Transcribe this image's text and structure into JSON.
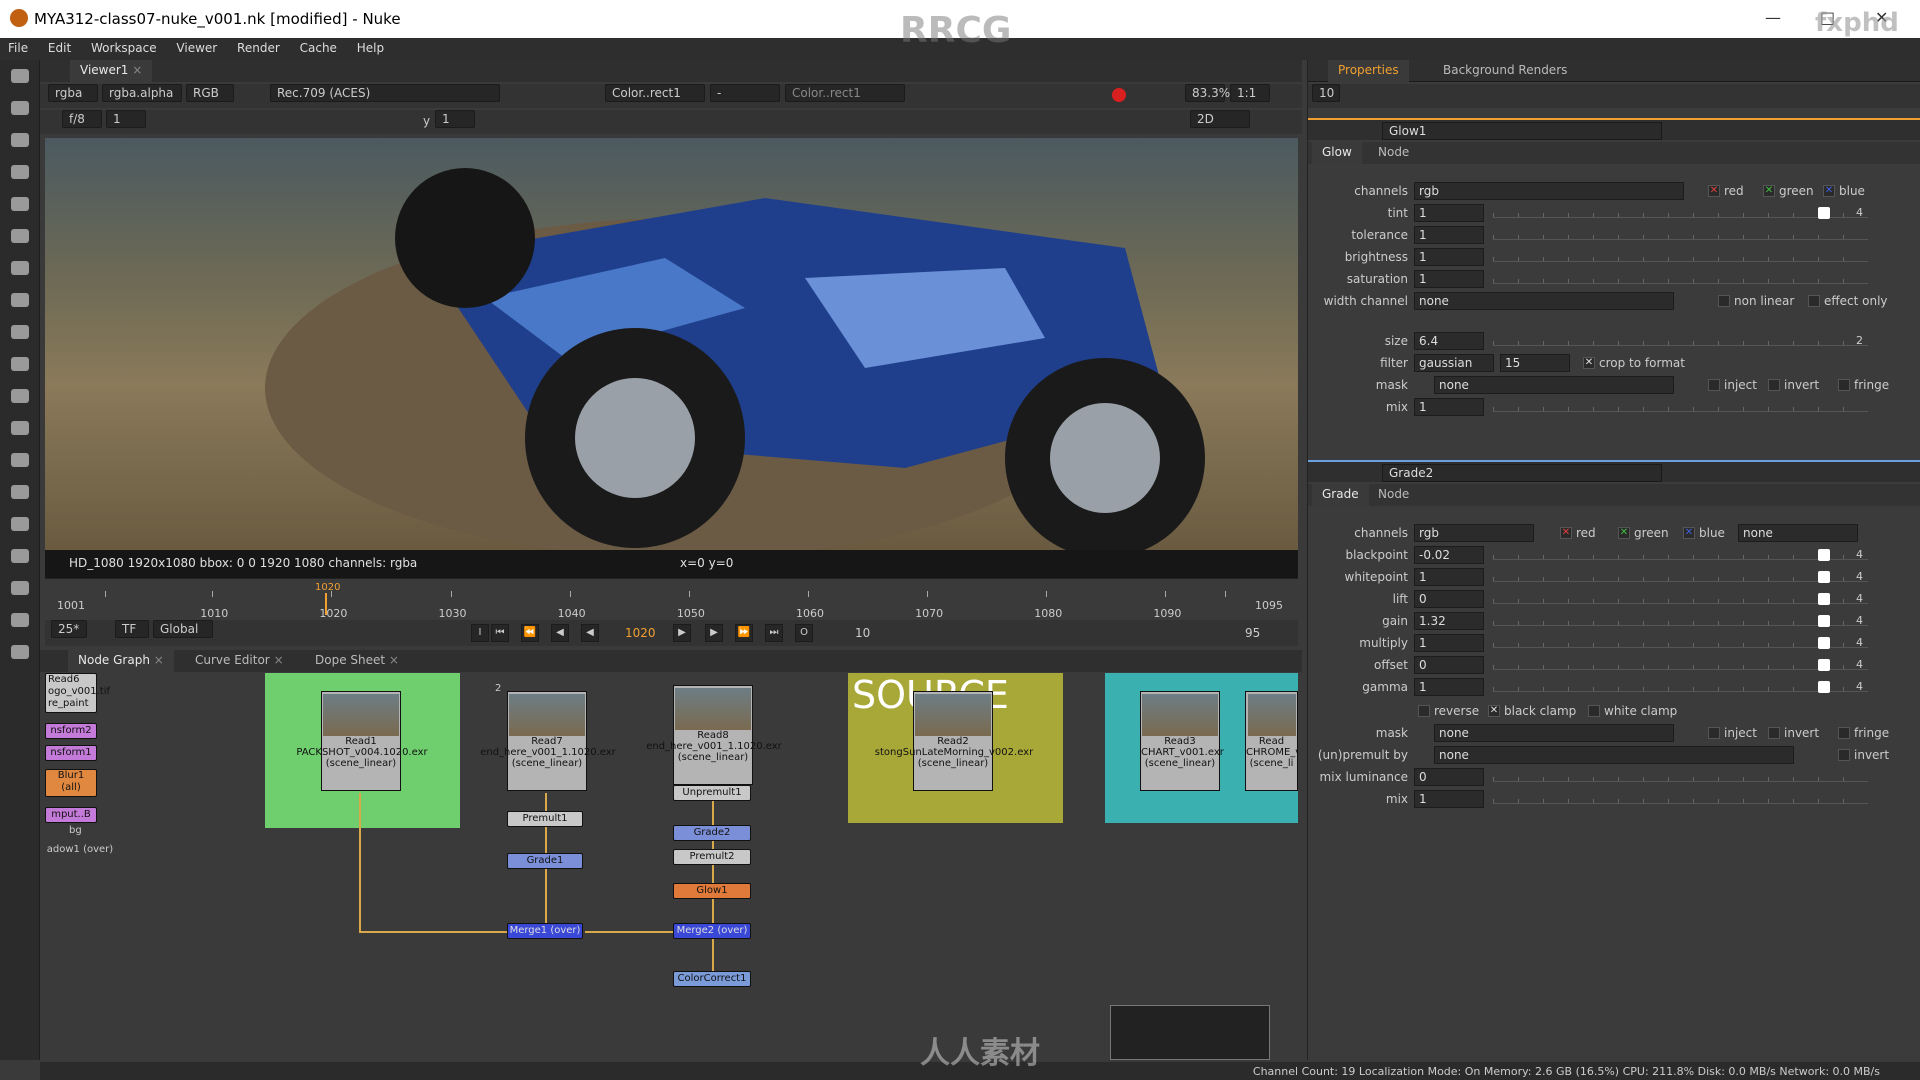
{
  "window": {
    "title": "MYA312-class07-nuke_v001.nk [modified] - Nuke",
    "controls": [
      "—",
      "□",
      "✕"
    ]
  },
  "menu": [
    "File",
    "Edit",
    "Workspace",
    "Viewer",
    "Render",
    "Cache",
    "Help"
  ],
  "viewer": {
    "tab": "Viewer1",
    "channels": "rgba",
    "alpha": "rgba.alpha",
    "display": "RGB",
    "colorspace": "Rec.709 (ACES)",
    "inputA": "Color..rect1",
    "inputB": "Color..rect1",
    "dash": "-",
    "fstop": "f/8",
    "frame_step": "1",
    "y_label": "y",
    "y_value": "1",
    "zoom": "83.3%",
    "ratio": "1:1",
    "mode": "2D",
    "info_left": "HD_1080 1920x1080  bbox: 0 0 1920 1080 channels: rgba",
    "info_coord": "x=0 y=0"
  },
  "timeline": {
    "start": "1001",
    "end": "1095",
    "current": "1020",
    "labels": [
      "1001",
      "1010",
      "1020",
      "1030",
      "1040",
      "1050",
      "1060",
      "1070",
      "1080",
      "1090",
      "1095"
    ],
    "fps": "25*",
    "tf": "TF",
    "scope": "Global",
    "frame_field": "1020",
    "skip": "10",
    "end_field": "95",
    "marker_I": "I",
    "marker_O": "O"
  },
  "graph_tabs": [
    "Node Graph",
    "Curve Editor",
    "Dope Sheet"
  ],
  "nodes": {
    "left_stack": [
      "Read6",
      "ogo_v001.tif",
      "re_paint",
      "nsform2",
      "nsform1",
      "Blur1",
      "(all)",
      "mput..B",
      "bg",
      "adow1 (over)"
    ],
    "read1": {
      "name": "Read1",
      "file": "PACKSHOT_v004.1020.exr",
      "cs": "(scene_linear)"
    },
    "read7": {
      "name": "Read7",
      "file": "end_here_v001_1.1020.exr",
      "cs": "(scene_linear)"
    },
    "read8": {
      "name": "Read8",
      "file": "end_here_v001_1.1020.exr",
      "cs": "(scene_linear)"
    },
    "read2": {
      "name": "Read2",
      "file": "stongSunLateMorning_v002.exr",
      "cs": "(scene_linear)"
    },
    "read3": {
      "name": "Read3",
      "file": "CHART_v001.exr",
      "cs": "(scene_linear)"
    },
    "read4": {
      "name": "Read",
      "file": "CHROME_v",
      "cs": "(scene_li"
    },
    "source_label": "SOURCE",
    "premult1": "Premult1",
    "grade1": "Grade1",
    "merge1": "Merge1 (over)",
    "unpremult1": "Unpremult1",
    "grade2": "Grade2",
    "premult2": "Premult2",
    "glow1": "Glow1",
    "merge2": "Merge2 (over)",
    "colorcorrect1": "ColorCorrect1",
    "input_num": "2"
  },
  "properties": {
    "tabs": [
      "Properties",
      "Background Renders"
    ],
    "max_panels": "10",
    "glow": {
      "name": "Glow1",
      "subtabs": [
        "Glow",
        "Node"
      ],
      "channels": "rgb",
      "red": "red",
      "green": "green",
      "blue": "blue",
      "tint": "1",
      "tolerance": "1",
      "brightness": "1",
      "saturation": "1",
      "width_channel": "none",
      "non_linear": "non linear",
      "effect_only": "effect only",
      "size": "6.4",
      "size_count": "2",
      "filter": "gaussian",
      "filter_val": "15",
      "crop": "crop to format",
      "mask": "none",
      "inject": "inject",
      "invert": "invert",
      "fringe": "fringe",
      "mix": "1",
      "labels": [
        "channels",
        "tint",
        "tolerance",
        "brightness",
        "saturation",
        "width channel",
        "size",
        "filter",
        "mask",
        "mix"
      ]
    },
    "grade": {
      "name": "Grade2",
      "subtabs": [
        "Grade",
        "Node"
      ],
      "channels": "rgb",
      "red": "red",
      "green": "green",
      "blue": "blue",
      "alpha_sel": "none",
      "blackpoint": "-0.02",
      "whitepoint": "1",
      "lift": "0",
      "gain": "1.32",
      "multiply": "1",
      "offset": "0",
      "gamma": "1",
      "reverse": "reverse",
      "black_clamp": "black clamp",
      "white_clamp": "white clamp",
      "mask": "none",
      "inject": "inject",
      "invert": "invert",
      "fringe": "fringe",
      "unpremult": "none",
      "unpremult_invert": "invert",
      "mix_luminance": "0",
      "mix": "1",
      "labels": [
        "channels",
        "blackpoint",
        "whitepoint",
        "lift",
        "gain",
        "multiply",
        "offset",
        "gamma",
        "mask",
        "(un)premult by",
        "mix luminance",
        "mix"
      ]
    },
    "count_label": "4"
  },
  "status": "Channel Count: 19  Localization Mode: On  Memory: 2.6 GB (16.5%)  CPU: 211.8%  Disk: 0.0 MB/s  Network: 0.0 MB/s",
  "watermarks": {
    "top": "RRCG",
    "corner": "fxphd",
    "bottom": "人人素材"
  },
  "colors": {
    "accent": "#f0a030",
    "read1_bd": "#6fcf6f",
    "source_bd": "#a8a838",
    "chart_bd": "#3ab0b0",
    "glow_node": "#e07a3a",
    "grade_node": "#7a8fd8",
    "merge_node": "#3a48d8"
  }
}
